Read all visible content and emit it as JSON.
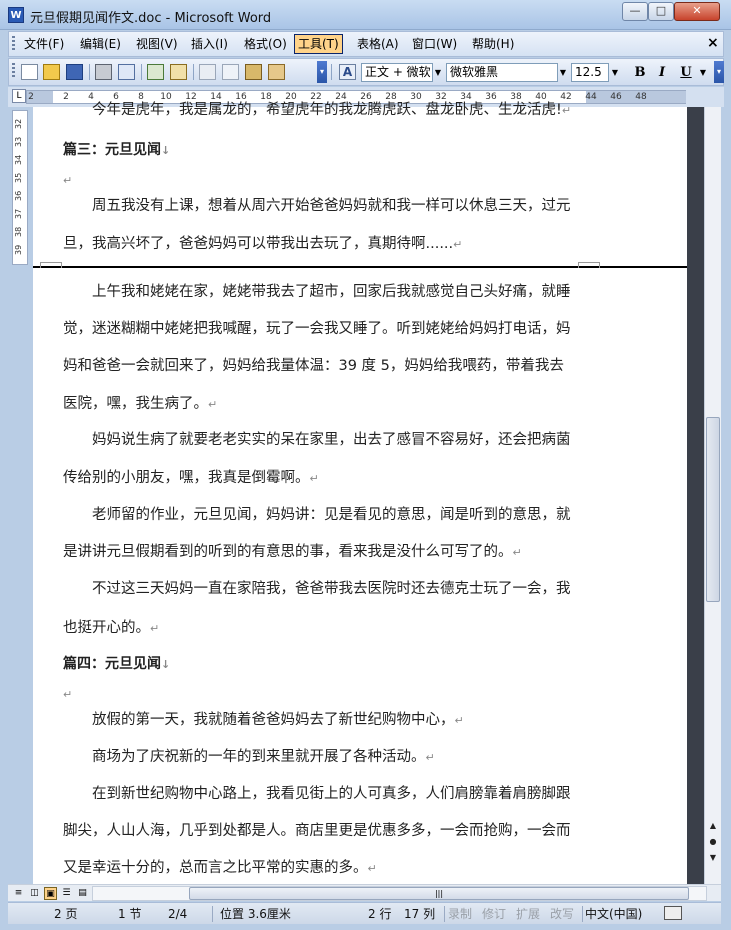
{
  "window": {
    "title": "元旦假期见闻作文.doc - Microsoft Word",
    "icon_letter": "W",
    "minimize_label": "—",
    "maximize_label": "□",
    "close_label": "✕"
  },
  "menu": {
    "items": [
      "文件(F)",
      "编辑(E)",
      "视图(V)",
      "插入(I)",
      "格式(O)",
      "工具(T)",
      "表格(A)",
      "窗口(W)",
      "帮助(H)"
    ],
    "active_item": "工具(T)",
    "close_label": "×"
  },
  "toolbar": {
    "style_combo": "正文 + 微软",
    "font_combo": "微软雅黑",
    "size_combo": "12.5",
    "bold": "B",
    "italic": "I",
    "underline": "U",
    "style_icon_glyph": "A",
    "icons": [
      "new-icon",
      "open-icon",
      "save-icon",
      "print-icon",
      "print-preview-icon",
      "spelling-icon",
      "research-icon",
      "cut-icon",
      "copy-icon",
      "paste-icon",
      "format-painter-icon",
      "styles-icon"
    ]
  },
  "ruler": {
    "corner": "L",
    "marks": [
      "2",
      "2",
      "4",
      "6",
      "8",
      "10",
      "12",
      "14",
      "16",
      "18",
      "20",
      "22",
      "24",
      "26",
      "28",
      "30",
      "32",
      "34",
      "36",
      "38",
      "40",
      "42",
      "44",
      "46",
      "48"
    ]
  },
  "vruler": {
    "marks": [
      "32",
      "33",
      "34",
      "35",
      "36",
      "37",
      "38",
      "39"
    ]
  },
  "document": {
    "lines": [
      {
        "text": "今年是虎年，我是属龙的，希望虎年的我龙腾虎跃、盘龙卧虎、生龙活虎!",
        "type": "indent"
      },
      {
        "text": "篇三：元旦见闻",
        "type": "heading"
      },
      {
        "text": "",
        "type": "empty"
      },
      {
        "text": "周五我没有上课，想着从周六开始爸爸妈妈就和我一样可以休息三天，过元",
        "type": "indent"
      },
      {
        "text": "旦，我高兴坏了，爸爸妈妈可以带我出去玩了，真期待啊......",
        "type": "body"
      },
      {
        "text": "上午我和姥姥在家，姥姥带我去了超市，回家后我就感觉自己头好痛，就睡",
        "type": "indent"
      },
      {
        "text": "觉，迷迷糊糊中姥姥把我喊醒，玩了一会我又睡了。听到姥姥给妈妈打电话，妈",
        "type": "body"
      },
      {
        "text": "妈和爸爸一会就回来了，妈妈给我量体温：39 度 5，妈妈给我喂药，带着我去",
        "type": "body"
      },
      {
        "text": "医院，嘿，我生病了。",
        "type": "body"
      },
      {
        "text": "妈妈说生病了就要老老实实的呆在家里，出去了感冒不容易好，还会把病菌",
        "type": "indent"
      },
      {
        "text": "传给别的小朋友，嘿，我真是倒霉啊。",
        "type": "body"
      },
      {
        "text": "老师留的作业，元旦见闻，妈妈讲：见是看见的意思，闻是听到的意思，就",
        "type": "indent"
      },
      {
        "text": "是讲讲元旦假期看到的听到的有意思的事，看来我是没什么可写了的。",
        "type": "body"
      },
      {
        "text": "不过这三天妈妈一直在家陪我，爸爸带我去医院时还去德克士玩了一会，我",
        "type": "indent"
      },
      {
        "text": "也挺开心的。",
        "type": "body"
      },
      {
        "text": "篇四：元旦见闻",
        "type": "heading"
      },
      {
        "text": "",
        "type": "empty"
      },
      {
        "text": "放假的第一天，我就随着爸爸妈妈去了新世纪购物中心，",
        "type": "indent"
      },
      {
        "text": "商场为了庆祝新的一年的到来里就开展了各种活动。",
        "type": "indent"
      },
      {
        "text": "在到新世纪购物中心路上，我看见街上的人可真多，人们肩膀靠着肩膀脚跟",
        "type": "indent"
      },
      {
        "text": "脚尖，人山人海，几乎到处都是人。商店里更是优惠多多，一会而抢购，一会而",
        "type": "body"
      },
      {
        "text": "又是幸运十分的，总而言之比平常的实惠的多。",
        "type": "body"
      }
    ],
    "para_mark": "↵",
    "heading_mark": "↓"
  },
  "statusbar": {
    "page": "2 页",
    "section": "1 节",
    "page_of": "2/4",
    "position": "位置 3.6厘米",
    "line": "2 行",
    "column": "17 列",
    "rec": "录制",
    "trk": "修订",
    "ext": "扩展",
    "ovr": "改写",
    "language": "中文(中国)"
  }
}
